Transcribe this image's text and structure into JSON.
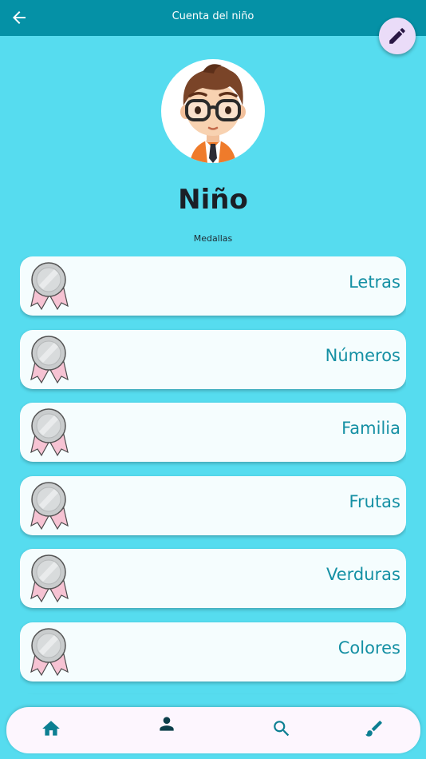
{
  "appbar": {
    "title": "Cuenta del niño"
  },
  "profile": {
    "name": "Niño"
  },
  "medals": {
    "title": "Medallas",
    "items": [
      {
        "label": "Letras"
      },
      {
        "label": "Números"
      },
      {
        "label": "Familia"
      },
      {
        "label": "Frutas"
      },
      {
        "label": "Verduras"
      },
      {
        "label": "Colores"
      },
      {
        "label": ""
      }
    ]
  },
  "bottom_nav": {
    "items": [
      {
        "icon": "home-icon"
      },
      {
        "icon": "person-icon"
      },
      {
        "icon": "search-icon"
      },
      {
        "icon": "brush-icon"
      }
    ]
  },
  "colors": {
    "background": "#56dcef",
    "appbar": "#0591a6",
    "card_text": "#1590a4",
    "nav_icon": "#0c7f92",
    "fab": "#eadcf8",
    "medal": "#c9cccd",
    "ribbon": "#f6c3d3"
  }
}
